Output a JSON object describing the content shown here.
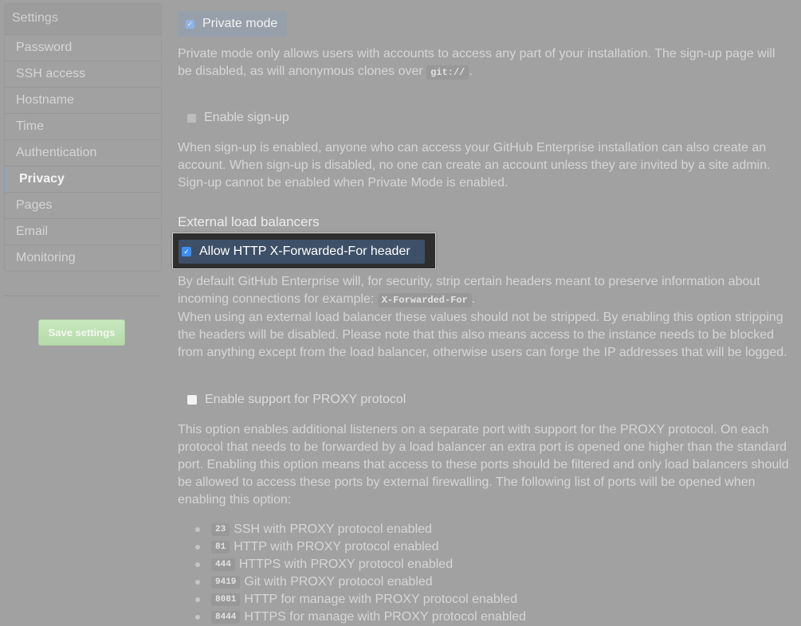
{
  "sidebar": {
    "heading": "Settings",
    "items": [
      {
        "label": "Password",
        "active": false
      },
      {
        "label": "SSH access",
        "active": false
      },
      {
        "label": "Hostname",
        "active": false
      },
      {
        "label": "Time",
        "active": false
      },
      {
        "label": "Authentication",
        "active": false
      },
      {
        "label": "Privacy",
        "active": true
      },
      {
        "label": "Pages",
        "active": false
      },
      {
        "label": "Email",
        "active": false
      },
      {
        "label": "Monitoring",
        "active": false
      }
    ],
    "save_label": "Save settings"
  },
  "private_mode": {
    "label": "Private mode",
    "checked": true,
    "desc_part1": "Private mode only allows users with accounts to access any part of your installation. The sign-up page will be disabled, as will anonymous clones over ",
    "desc_code": "git://",
    "desc_part2": "."
  },
  "signup": {
    "label": "Enable sign-up",
    "checked": false,
    "desc": "When sign-up is enabled, anyone who can access your GitHub Enterprise installation can also create an account. When sign-up is disabled, no one can create an account unless they are invited by a site admin. Sign-up cannot be enabled when Private Mode is enabled."
  },
  "load_balancers": {
    "heading": "External load balancers",
    "xff_label": "Allow HTTP X-Forwarded-For header",
    "xff_checked": true,
    "desc_part1": "By default GitHub Enterprise will, for security, strip certain headers meant to preserve information about incoming connections for example: ",
    "desc_code": "X-Forwarded-For",
    "desc_part2": ".",
    "desc_part3": "When using an external load balancer these values should not be stripped. By enabling this option stripping the headers will be disabled. Please note that this also means access to the instance needs to be blocked from anything except from the load balancer, otherwise users can forge the IP addresses that will be logged."
  },
  "proxy": {
    "label": "Enable support for PROXY protocol",
    "checked": false,
    "desc": "This option enables additional listeners on a separate port with support for the PROXY protocol. On each protocol that needs to be forwarded by a load balancer an extra port is opened one higher than the standard port. Enabling this option means that access to these ports should be filtered and only load balancers should be allowed to access these ports by external firewalling. The following list of ports will be opened when enabling this option:",
    "ports": [
      {
        "port": "23",
        "text": "SSH with PROXY protocol enabled"
      },
      {
        "port": "81",
        "text": "HTTP with PROXY protocol enabled"
      },
      {
        "port": "444",
        "text": "HTTPS with PROXY protocol enabled"
      },
      {
        "port": "9419",
        "text": "Git with PROXY protocol enabled"
      },
      {
        "port": "8081",
        "text": "HTTP for manage with PROXY protocol enabled"
      },
      {
        "port": "8444",
        "text": "HTTPS for manage with PROXY protocol enabled"
      }
    ]
  },
  "colors": {
    "accent": "#3d8ef0",
    "highlight_bg": "#3e5068",
    "save_button": "#c8e8be"
  }
}
